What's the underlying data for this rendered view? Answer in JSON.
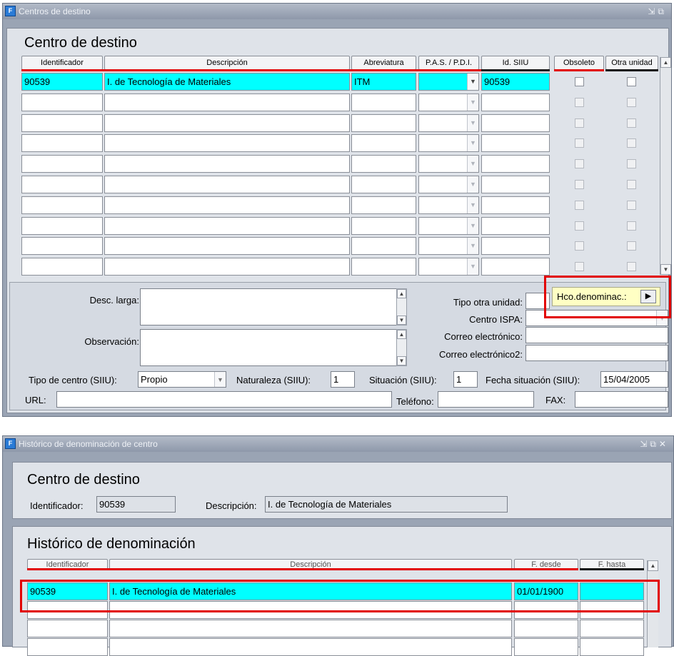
{
  "window1": {
    "title": "Centros de destino",
    "heading": "Centro de destino",
    "columns": [
      "Identificador",
      "Descripción",
      "Abreviatura",
      "P.A.S. / P.D.I.",
      "Id. SIIU",
      "Obsoleto",
      "Otra unidad"
    ],
    "first_row": {
      "identificador": "90539",
      "descripcion": "I. de Tecnología de Materiales",
      "abreviatura": "ITM",
      "id_siiu": "90539"
    },
    "labels": {
      "desc_larga": "Desc. larga:",
      "observacion": "Observación:",
      "tipo_otra_unidad": "Tipo otra unidad:",
      "centro_ispa": "Centro ISPA:",
      "correo": "Correo electrónico:",
      "correo2": "Correo electrónico2:",
      "tipo_centro": "Tipo de centro (SIIU):",
      "naturaleza": "Naturaleza (SIIU):",
      "situacion": "Situación (SIIU):",
      "fecha_situacion": "Fecha situación (SIIU):",
      "url": "URL:",
      "telefono": "Teléfono:",
      "fax": "FAX:"
    },
    "values": {
      "tipo_centro": "Propio",
      "naturaleza": "1",
      "situacion": "1",
      "fecha_situacion": "15/04/2005"
    },
    "hco_button": "Hco.denominac.:"
  },
  "window2": {
    "title": "Histórico de denominación de centro",
    "heading": "Centro de destino",
    "ident_label": "Identificador:",
    "ident_value": "90539",
    "desc_label": "Descripción:",
    "desc_value": "I. de Tecnología de Materiales",
    "heading2": "Histórico de denominación",
    "columns": [
      "Identificador",
      "Descripción",
      "F. desde",
      "F. hasta"
    ],
    "first_row": {
      "identificador": "90539",
      "descripcion": "I. de Tecnología de Materiales",
      "f_desde": "01/01/1900",
      "f_hasta": ""
    }
  },
  "colors": {
    "selected": "#00ffff",
    "highlight": "#e20000",
    "tooltip": "#ffffc4"
  }
}
